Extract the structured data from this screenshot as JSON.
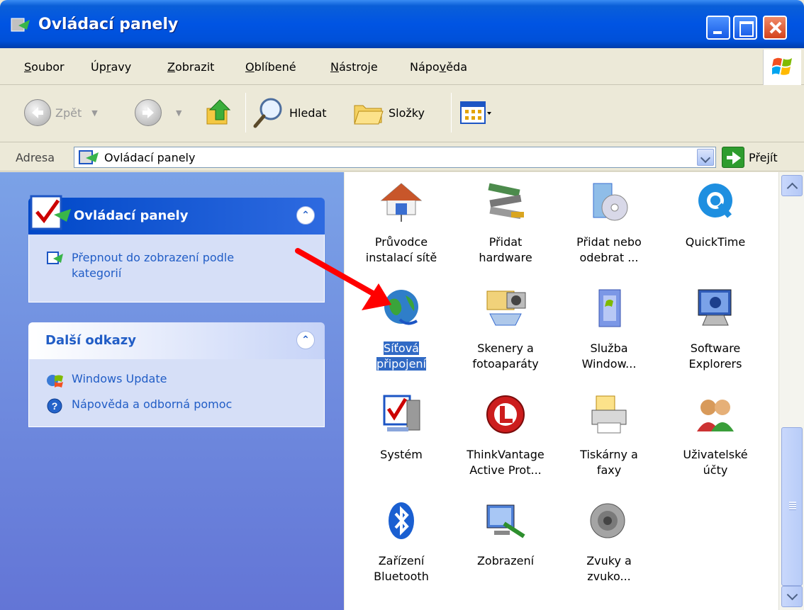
{
  "window": {
    "title": "Ovládací panely"
  },
  "menu": [
    "Soubor",
    "Úpravy",
    "Zobrazit",
    "Oblíbené",
    "Nástroje",
    "Nápověda"
  ],
  "menu_ul": [
    "S",
    "r",
    "Z",
    "O",
    "N",
    "v"
  ],
  "toolbar": {
    "back": "Zpět",
    "search": "Hledat",
    "folders": "Složky"
  },
  "address": {
    "label": "Adresa",
    "value": "Ovládací panely",
    "go": "Přejít"
  },
  "taskpane": {
    "panel1": {
      "title": "Ovládací panely",
      "link": "Přepnout do zobrazení podle kategorií"
    },
    "panel2": {
      "title": "Další odkazy",
      "links": [
        "Windows Update",
        "Nápověda a odborná pomoc"
      ]
    }
  },
  "items": [
    {
      "line1": "Průvodce",
      "line2": "instalací sítě"
    },
    {
      "line1": "Přidat",
      "line2": "hardware"
    },
    {
      "line1": "Přidat nebo",
      "line2": "odebrat ..."
    },
    {
      "line1": "QuickTime",
      "line2": ""
    },
    {
      "line1": "Síťová",
      "line2": "připojení"
    },
    {
      "line1": "Skenery a",
      "line2": "fotoaparáty"
    },
    {
      "line1": "Služba",
      "line2": "Window..."
    },
    {
      "line1": "Software",
      "line2": "Explorers"
    },
    {
      "line1": "Systém",
      "line2": ""
    },
    {
      "line1": "ThinkVantage",
      "line2": "Active Prot..."
    },
    {
      "line1": "Tiskárny a",
      "line2": "faxy"
    },
    {
      "line1": "Uživatelské",
      "line2": "účty"
    },
    {
      "line1": "Zařízení",
      "line2": "Bluetooth"
    },
    {
      "line1": "Zobrazení",
      "line2": ""
    },
    {
      "line1": "Zvuky a",
      "line2": "zvuko..."
    }
  ],
  "colors": {
    "title_blue": "#0054e3",
    "selection": "#316ac5",
    "link": "#215dc6",
    "arrow": "#ff0000"
  }
}
